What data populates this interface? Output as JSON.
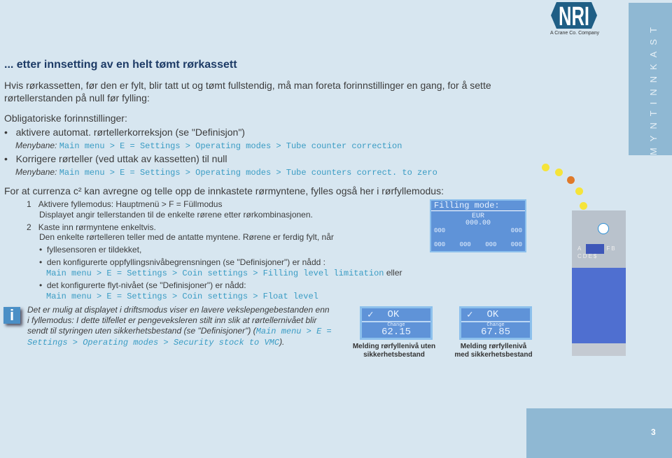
{
  "logo": {
    "text": "NRI",
    "tagline": "A Crane Co. Company",
    "color": "#1f5e85"
  },
  "side_tab": "MYNTINNKAST",
  "title": "... etter innsetting av en helt tømt rørkassett",
  "intro": [
    "Hvis rørkassetten, før den er fylt, blir tatt ut og tømt fullstendig, må man foreta forinnstillinger en gang, for å sette",
    "rørtellerstanden på null før fylling:"
  ],
  "obligatory": "Obligatoriske forinnstillinger:",
  "bullets": [
    {
      "text": "aktivere automat. rørtellerkorreksjon (se \"Definisjon\")",
      "label": "Menybane:",
      "path": "Main menu > E = Settings > Operating modes > Tube counter correction"
    },
    {
      "text": "Korrigere rørteller (ved uttak av kassetten) til null",
      "label": "Menybane:",
      "path": "Main menu > E = Settings > Operating modes > Tube counters correct. to zero"
    }
  ],
  "para": "For at currenza c² kan avregne og telle opp de innkastete rørmyntene, fylles også her i rørfyllemodus:",
  "steps": [
    {
      "num": "1",
      "text": "Aktivere fyllemodus: Hauptmenü > F = Füllmodus",
      "sub": "Displayet angir tellerstanden til de enkelte rørene etter rørkombinasjonen."
    },
    {
      "num": "2",
      "text": "Kaste inn rørmyntene enkeltvis.",
      "sub": "Den enkelte rørtelleren teller med de antatte myntene. Rørene er ferdig fylt, når"
    }
  ],
  "conditions": [
    {
      "text": "fyllesensoren er tildekket,"
    },
    {
      "text": "den konfigurerte oppfyllingsnivåbegrensningen (se \"Definisjoner\") er nådd      :",
      "path": "Main menu > E = Settings > Coin settings > Filling level limitation",
      "after": "eller"
    },
    {
      "text": "det konfigurerte flyt-nivået (se \"Definisjoner\") er nådd:",
      "path": "Main menu > E = Settings > Coin settings > Float level"
    }
  ],
  "info": {
    "lines": [
      "Det er mulig at displayet i driftsmodus viser en lavere vekslepengebestanden enn",
      "i fyllemodus: I dette tilfellet er pengeveksleren stilt inn slik at rørtellernivået blir",
      "sendt til styringen uten sikkerhetsbestand (se \"Definisjoner\") ("
    ],
    "path1": "Main menu > E =",
    "path2": "Settings > Operating modes > Security stock to VMC",
    "end": ")."
  },
  "filling_display": {
    "title": "Filling mode:",
    "currency": "EUR",
    "amount": "000.00",
    "counter": "000"
  },
  "displays": [
    {
      "ok": "OK",
      "label": "Change",
      "value": "62.15",
      "caption": [
        "Melding rørfyllenivå uten",
        "sikkerhetsbestand"
      ]
    },
    {
      "ok": "OK",
      "label": "Change",
      "value": "67.85",
      "caption": [
        "Melding rørfyllenivå",
        "med sikkerhetsbestand"
      ]
    }
  ],
  "machine_keys": [
    "A",
    "F",
    "B",
    "C",
    "D",
    "E",
    "$"
  ],
  "page_number": "3"
}
